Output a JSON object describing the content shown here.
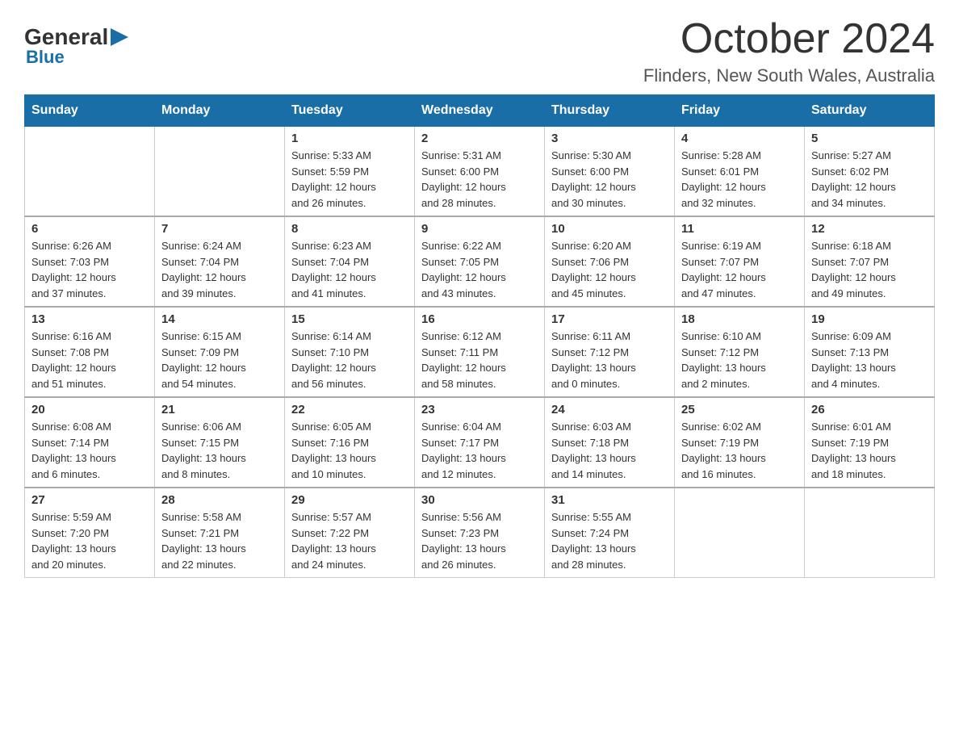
{
  "header": {
    "logo_general": "General",
    "logo_blue": "Blue",
    "month_title": "October 2024",
    "location": "Flinders, New South Wales, Australia"
  },
  "weekdays": [
    "Sunday",
    "Monday",
    "Tuesday",
    "Wednesday",
    "Thursday",
    "Friday",
    "Saturday"
  ],
  "weeks": [
    [
      {
        "day": "",
        "info": ""
      },
      {
        "day": "",
        "info": ""
      },
      {
        "day": "1",
        "info": "Sunrise: 5:33 AM\nSunset: 5:59 PM\nDaylight: 12 hours\nand 26 minutes."
      },
      {
        "day": "2",
        "info": "Sunrise: 5:31 AM\nSunset: 6:00 PM\nDaylight: 12 hours\nand 28 minutes."
      },
      {
        "day": "3",
        "info": "Sunrise: 5:30 AM\nSunset: 6:00 PM\nDaylight: 12 hours\nand 30 minutes."
      },
      {
        "day": "4",
        "info": "Sunrise: 5:28 AM\nSunset: 6:01 PM\nDaylight: 12 hours\nand 32 minutes."
      },
      {
        "day": "5",
        "info": "Sunrise: 5:27 AM\nSunset: 6:02 PM\nDaylight: 12 hours\nand 34 minutes."
      }
    ],
    [
      {
        "day": "6",
        "info": "Sunrise: 6:26 AM\nSunset: 7:03 PM\nDaylight: 12 hours\nand 37 minutes."
      },
      {
        "day": "7",
        "info": "Sunrise: 6:24 AM\nSunset: 7:04 PM\nDaylight: 12 hours\nand 39 minutes."
      },
      {
        "day": "8",
        "info": "Sunrise: 6:23 AM\nSunset: 7:04 PM\nDaylight: 12 hours\nand 41 minutes."
      },
      {
        "day": "9",
        "info": "Sunrise: 6:22 AM\nSunset: 7:05 PM\nDaylight: 12 hours\nand 43 minutes."
      },
      {
        "day": "10",
        "info": "Sunrise: 6:20 AM\nSunset: 7:06 PM\nDaylight: 12 hours\nand 45 minutes."
      },
      {
        "day": "11",
        "info": "Sunrise: 6:19 AM\nSunset: 7:07 PM\nDaylight: 12 hours\nand 47 minutes."
      },
      {
        "day": "12",
        "info": "Sunrise: 6:18 AM\nSunset: 7:07 PM\nDaylight: 12 hours\nand 49 minutes."
      }
    ],
    [
      {
        "day": "13",
        "info": "Sunrise: 6:16 AM\nSunset: 7:08 PM\nDaylight: 12 hours\nand 51 minutes."
      },
      {
        "day": "14",
        "info": "Sunrise: 6:15 AM\nSunset: 7:09 PM\nDaylight: 12 hours\nand 54 minutes."
      },
      {
        "day": "15",
        "info": "Sunrise: 6:14 AM\nSunset: 7:10 PM\nDaylight: 12 hours\nand 56 minutes."
      },
      {
        "day": "16",
        "info": "Sunrise: 6:12 AM\nSunset: 7:11 PM\nDaylight: 12 hours\nand 58 minutes."
      },
      {
        "day": "17",
        "info": "Sunrise: 6:11 AM\nSunset: 7:12 PM\nDaylight: 13 hours\nand 0 minutes."
      },
      {
        "day": "18",
        "info": "Sunrise: 6:10 AM\nSunset: 7:12 PM\nDaylight: 13 hours\nand 2 minutes."
      },
      {
        "day": "19",
        "info": "Sunrise: 6:09 AM\nSunset: 7:13 PM\nDaylight: 13 hours\nand 4 minutes."
      }
    ],
    [
      {
        "day": "20",
        "info": "Sunrise: 6:08 AM\nSunset: 7:14 PM\nDaylight: 13 hours\nand 6 minutes."
      },
      {
        "day": "21",
        "info": "Sunrise: 6:06 AM\nSunset: 7:15 PM\nDaylight: 13 hours\nand 8 minutes."
      },
      {
        "day": "22",
        "info": "Sunrise: 6:05 AM\nSunset: 7:16 PM\nDaylight: 13 hours\nand 10 minutes."
      },
      {
        "day": "23",
        "info": "Sunrise: 6:04 AM\nSunset: 7:17 PM\nDaylight: 13 hours\nand 12 minutes."
      },
      {
        "day": "24",
        "info": "Sunrise: 6:03 AM\nSunset: 7:18 PM\nDaylight: 13 hours\nand 14 minutes."
      },
      {
        "day": "25",
        "info": "Sunrise: 6:02 AM\nSunset: 7:19 PM\nDaylight: 13 hours\nand 16 minutes."
      },
      {
        "day": "26",
        "info": "Sunrise: 6:01 AM\nSunset: 7:19 PM\nDaylight: 13 hours\nand 18 minutes."
      }
    ],
    [
      {
        "day": "27",
        "info": "Sunrise: 5:59 AM\nSunset: 7:20 PM\nDaylight: 13 hours\nand 20 minutes."
      },
      {
        "day": "28",
        "info": "Sunrise: 5:58 AM\nSunset: 7:21 PM\nDaylight: 13 hours\nand 22 minutes."
      },
      {
        "day": "29",
        "info": "Sunrise: 5:57 AM\nSunset: 7:22 PM\nDaylight: 13 hours\nand 24 minutes."
      },
      {
        "day": "30",
        "info": "Sunrise: 5:56 AM\nSunset: 7:23 PM\nDaylight: 13 hours\nand 26 minutes."
      },
      {
        "day": "31",
        "info": "Sunrise: 5:55 AM\nSunset: 7:24 PM\nDaylight: 13 hours\nand 28 minutes."
      },
      {
        "day": "",
        "info": ""
      },
      {
        "day": "",
        "info": ""
      }
    ]
  ]
}
